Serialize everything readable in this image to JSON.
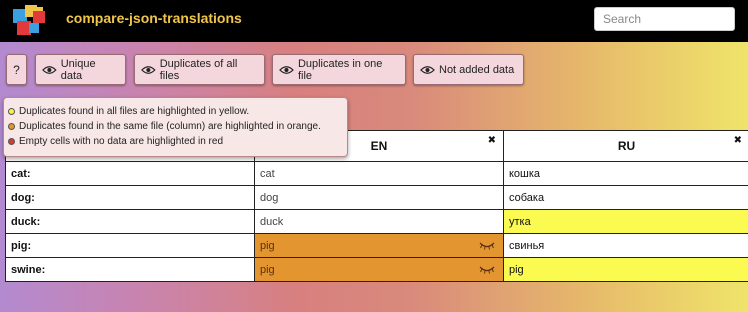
{
  "app": {
    "title": "compare-json-translations"
  },
  "search": {
    "placeholder": "Search"
  },
  "toolbar": {
    "help_label": "?",
    "buttons": [
      {
        "label": "Unique data"
      },
      {
        "label": "Duplicates of all files"
      },
      {
        "label": "Duplicates in one file"
      },
      {
        "label": "Not added data"
      }
    ]
  },
  "legend": {
    "items": [
      {
        "text": "Duplicates found in all files are highlighted in yellow.",
        "color": "#f5f04a"
      },
      {
        "text": "Duplicates found in the same file (column) are highlighted in orange.",
        "color": "#e39630"
      },
      {
        "text": "Empty cells with no data are highlighted in red",
        "color": "#d83b3b"
      }
    ]
  },
  "table": {
    "columns": [
      {
        "label": ""
      },
      {
        "label": "EN",
        "close": "✖"
      },
      {
        "label": "RU",
        "close": "✖"
      }
    ],
    "rows": [
      {
        "key": "cat:",
        "en": "cat",
        "ru": "кошка"
      },
      {
        "key": "dog:",
        "en": "dog",
        "ru": "собака"
      },
      {
        "key": "duck:",
        "en": "duck",
        "ru": "утка"
      },
      {
        "key": "pig:",
        "en": "pig",
        "ru": "свинья"
      },
      {
        "key": "swine:",
        "en": "pig",
        "ru": "pig"
      }
    ]
  },
  "colors": {
    "yellow": "#fafa50",
    "orange": "#e39630",
    "accent": "#f0c64a"
  }
}
